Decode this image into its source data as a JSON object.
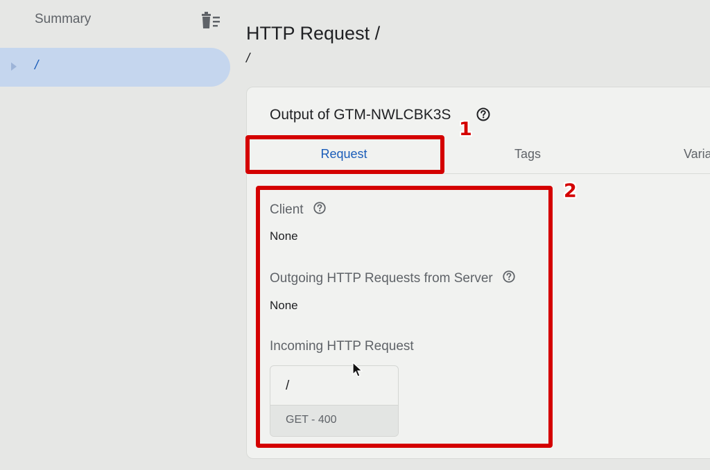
{
  "sidebar": {
    "title": "Summary",
    "clear_icon": "clear-all-icon",
    "items": [
      {
        "label": "/",
        "expand_icon": "chevron-right-icon"
      }
    ]
  },
  "header": {
    "title": "HTTP Request /",
    "subtitle": "/"
  },
  "card": {
    "title": "Output of GTM-NWLCBK3S",
    "help_icon": "help-circle-icon",
    "tabs": [
      {
        "label": "Request",
        "selected": true
      },
      {
        "label": "Tags",
        "selected": false
      },
      {
        "label": "Varia",
        "selected": false
      }
    ],
    "sections": {
      "client": {
        "label": "Client",
        "value": "None"
      },
      "outgoing": {
        "label": "Outgoing HTTP Requests from Server",
        "value": "None"
      },
      "incoming": {
        "label": "Incoming HTTP Request"
      }
    },
    "incoming_request": {
      "path": "/",
      "method_status": "GET - 400"
    }
  },
  "annotations": {
    "badge_1": "1",
    "badge_2": "2",
    "color": "#d40000"
  },
  "colors": {
    "accent": "#1a5cb8",
    "selected_bg": "#c5d6ee"
  }
}
